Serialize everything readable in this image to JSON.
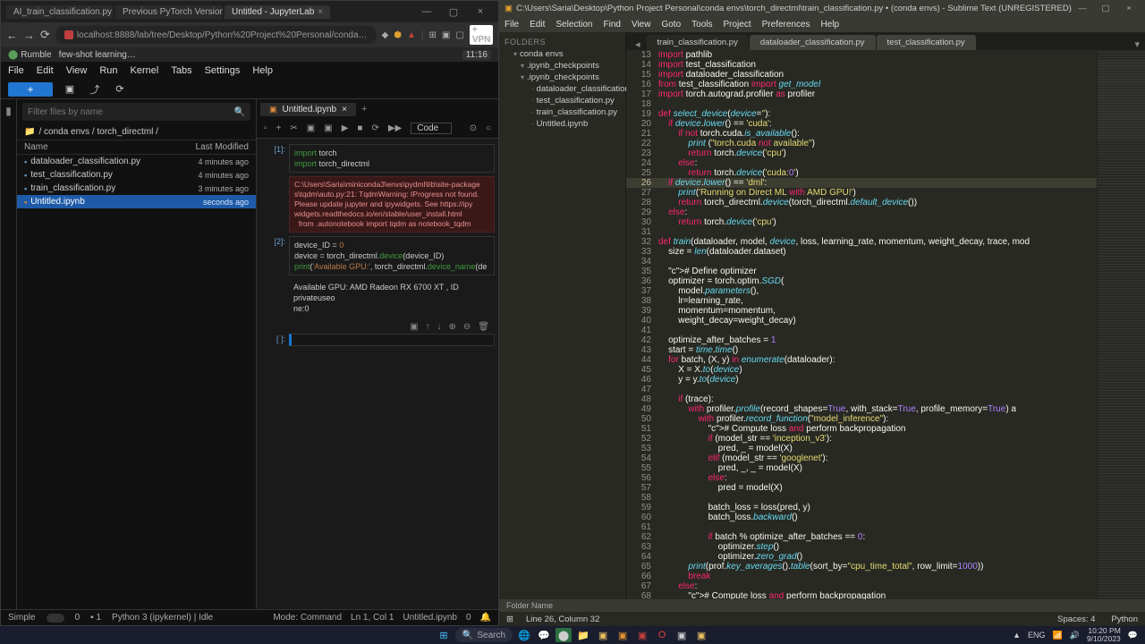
{
  "jupyter": {
    "browser_tabs": [
      {
        "label": "AI_train_classification.py at m..."
      },
      {
        "label": "Previous PyTorch Versions | PyTorc"
      },
      {
        "label": "Untitled - JupyterLab",
        "active": true
      }
    ],
    "time_badge": "11:16",
    "url": "localhost:8888/lab/tree/Desktop/Python%20Project%20Personal/conda…",
    "vpn": "+ VPN",
    "bookmark": "few-shot learning…",
    "bookmark_site": "Rumble",
    "menu": [
      "File",
      "Edit",
      "View",
      "Run",
      "Kernel",
      "Tabs",
      "Settings",
      "Help"
    ],
    "filter_placeholder": "Filter files by name",
    "crumb": "/ conda envs / torch_directml /",
    "file_cols": {
      "name": "Name",
      "mod": "Last Modified"
    },
    "files": [
      {
        "n": "dataloader_classification.py",
        "t": "4 minutes ago",
        "i": "py"
      },
      {
        "n": "test_classification.py",
        "t": "4 minutes ago",
        "i": "py"
      },
      {
        "n": "train_classification.py",
        "t": "3 minutes ago",
        "i": "py"
      },
      {
        "n": "Untitled.ipynb",
        "t": "seconds ago",
        "i": "nb",
        "sel": true
      }
    ],
    "nb_tab": "Untitled.ipynb",
    "code_dd": "Code",
    "cell1_prompt": "[1]:",
    "cell1_code": "import torch\nimport torch_directml",
    "cell1_err": "C:\\Users\\Saria\\miniconda3\\envs\\pydml\\lib\\site-package\ns\\tqdm\\auto.py:21: TqdmWarning: IProgress not found.\nPlease update jupyter and ipywidgets. See https://ipy\nwidgets.readthedocs.io/en/stable/user_install.html\n  from .autonotebook import tqdm as notebook_tqdm",
    "cell2_prompt": "[2]:",
    "cell2_code": "device_ID = 0\ndevice = torch_directml.device(device_ID)\nprint('Available GPU:', torch_directml.device_name(de",
    "cell2_out": "Available GPU: AMD Radeon RX 6700 XT , ID privateuseo\nne:0",
    "cell3_prompt": "[ ]:",
    "status": {
      "simple": "Simple",
      "idx": "0",
      "py": "Python 3 (ipykernel) | Idle",
      "mode": "Mode: Command",
      "ln": "Ln 1, Col 1",
      "file": "Untitled.ipynb",
      "sav": "0"
    }
  },
  "sublime": {
    "title": "C:\\Users\\Saria\\Desktop\\Python Project Personal\\conda envs\\torch_directml\\train_classification.py • (conda envs) - Sublime Text (UNREGISTERED)",
    "menu": [
      "File",
      "Edit",
      "Selection",
      "Find",
      "View",
      "Goto",
      "Tools",
      "Project",
      "Preferences",
      "Help"
    ],
    "folders_hdr": "FOLDERS",
    "tree": [
      {
        "l": "conda envs",
        "d": 0,
        "f": true
      },
      {
        "l": ".ipynb_checkpoints",
        "d": 1,
        "f": true
      },
      {
        "l": ".ipynb_checkpoints",
        "d": 1,
        "f": true
      },
      {
        "l": "dataloader_classification.py",
        "d": 2
      },
      {
        "l": "test_classification.py",
        "d": 2
      },
      {
        "l": "train_classification.py",
        "d": 2
      },
      {
        "l": "Untitled.ipynb",
        "d": 2
      }
    ],
    "tabs": [
      {
        "l": "train_classification.py",
        "a": true
      },
      {
        "l": "dataloader_classification.py"
      },
      {
        "l": "test_classification.py"
      }
    ],
    "first_line": 13,
    "hl_line": 26,
    "code_lines": [
      "import pathlib",
      "import test_classification",
      "import dataloader_classification",
      "from test_classification import get_model",
      "import torch.autograd.profiler as profiler",
      "",
      "def select_device(device=''):",
      "    if device.lower() == 'cuda':",
      "        if not torch.cuda.is_available():",
      "            print (\"torch.cuda not available\")",
      "            return torch.device('cpu')",
      "        else:",
      "            return torch.device('cuda:0')",
      "    if device.lower() == 'dml':",
      "        print('Running on Direct ML with AMD GPU!')",
      "        return torch_directml.device(torch_directml.default_device())",
      "    else:",
      "        return torch.device('cpu')",
      "",
      "def train(dataloader, model, device, loss, learning_rate, momentum, weight_decay, trace, mod",
      "    size = len(dataloader.dataset)",
      "",
      "    # Define optimizer",
      "    optimizer = torch.optim.SGD(",
      "        model.parameters(),",
      "        lr=learning_rate,",
      "        momentum=momentum,",
      "        weight_decay=weight_decay)",
      "",
      "    optimize_after_batches = 1",
      "    start = time.time()",
      "    for batch, (X, y) in enumerate(dataloader):",
      "        X = X.to(device)",
      "        y = y.to(device)",
      "",
      "        if (trace):",
      "            with profiler.profile(record_shapes=True, with_stack=True, profile_memory=True) a",
      "                with profiler.record_function(\"model_inference\"):",
      "                    # Compute loss and perform backpropagation",
      "                    if (model_str == 'inception_v3'):",
      "                        pred, _ = model(X)",
      "                    elif (model_str == 'googlenet'):",
      "                        pred, _, _ = model(X)",
      "                    else:",
      "                        pred = model(X)",
      "",
      "                    batch_loss = loss(pred, y)",
      "                    batch_loss.backward()",
      "",
      "                    if batch % optimize_after_batches == 0:",
      "                        optimizer.step()",
      "                        optimizer.zero_grad()",
      "            print(prof.key_averages().table(sort_by=\"cpu_time_total\", row_limit=1000))",
      "            break",
      "        else:",
      "            # Compute loss and perform backpropagation"
    ],
    "footer_hint": "Folder Name",
    "status_pos": "Line 26, Column 32",
    "status_spaces": "Spaces: 4",
    "status_lang": "Python"
  },
  "taskbar": {
    "search": "Search",
    "tray": {
      "net": "▲",
      "lang": "ENG",
      "time1": "10:20 PM",
      "time2": "9/10/2023"
    }
  }
}
